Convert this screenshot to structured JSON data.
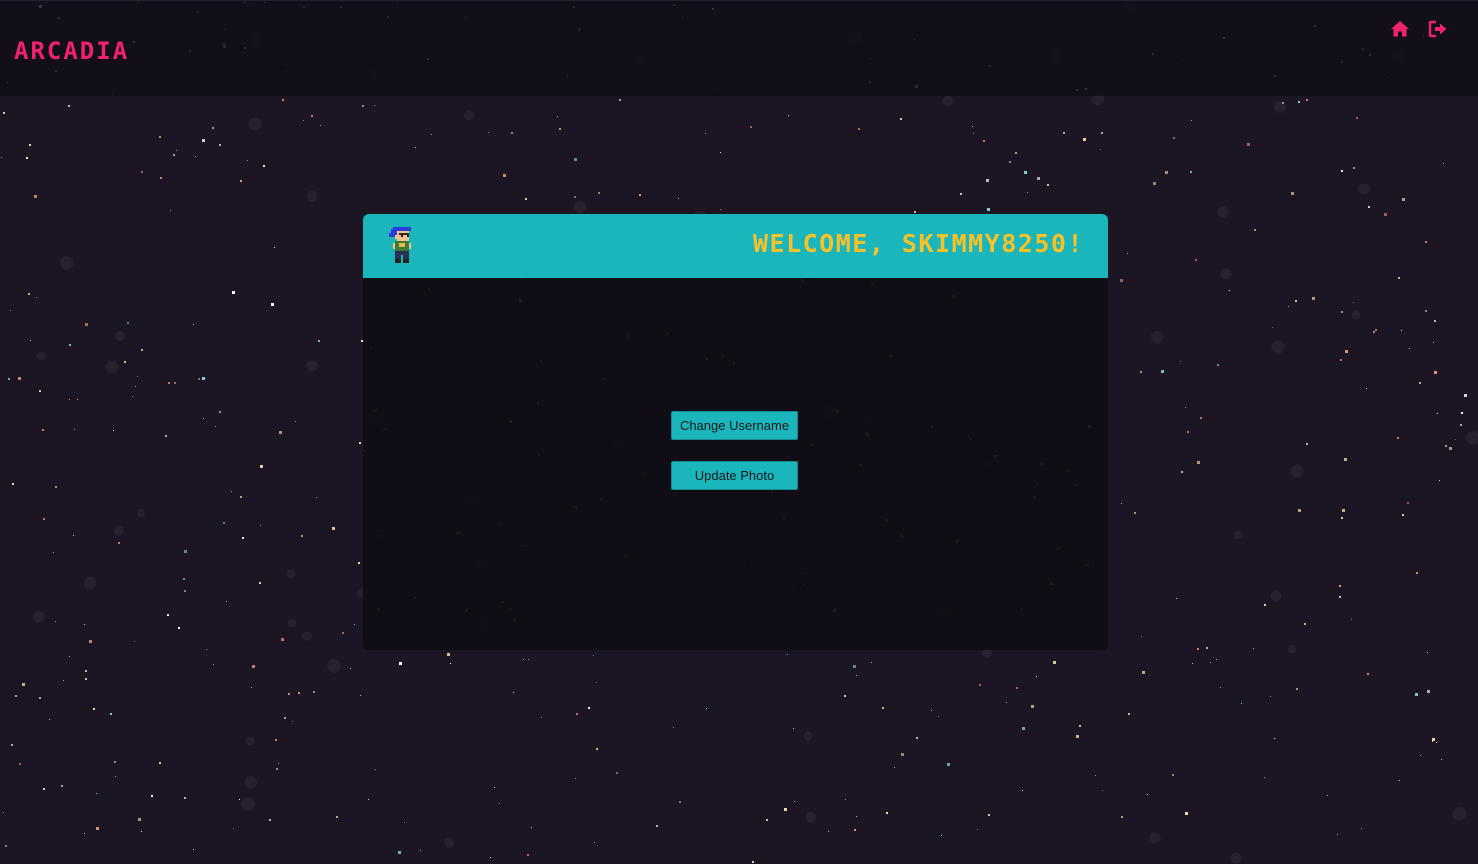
{
  "app": {
    "title": "ARCADIA"
  },
  "nav": {
    "home_icon": "home-icon",
    "logout_icon": "sign-out-icon"
  },
  "profile": {
    "welcome_text": "WELCOME, SKIMMY8250!",
    "avatar_icon": "pixel-character-avatar"
  },
  "actions": {
    "change_username_label": "Change Username",
    "update_photo_label": "Update Photo"
  },
  "colors": {
    "accent_pink": "#f0226e",
    "accent_teal": "#1bb6bc",
    "welcome_yellow": "#f5c229",
    "background": "#1c1624"
  }
}
